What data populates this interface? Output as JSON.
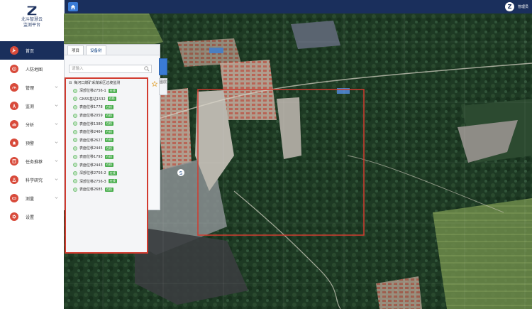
{
  "app": {
    "logo_text_line1": "北斗智慧云",
    "logo_text_line2": "监测平台",
    "user_avatar_letter": "Z",
    "user_name": "管理员"
  },
  "sidebar": {
    "items": [
      {
        "label": "首页",
        "icon": "wrench-icon",
        "active": true,
        "has_chevron": false
      },
      {
        "label": "人防地图",
        "icon": "target-icon",
        "active": false,
        "has_chevron": false
      },
      {
        "label": "管理",
        "icon": "dashboard-icon",
        "active": false,
        "has_chevron": true
      },
      {
        "label": "监测",
        "icon": "signal-tower-icon",
        "active": false,
        "has_chevron": true
      },
      {
        "label": "分析",
        "icon": "chart-icon",
        "active": false,
        "has_chevron": true
      },
      {
        "label": "预警",
        "icon": "alarm-icon",
        "active": false,
        "has_chevron": true
      },
      {
        "label": "任务推荐",
        "icon": "task-icon",
        "active": false,
        "has_chevron": true
      },
      {
        "label": "科学研究",
        "icon": "research-icon",
        "active": false,
        "has_chevron": true
      },
      {
        "label": "测量",
        "icon": "measure-icon",
        "active": false,
        "has_chevron": true
      },
      {
        "label": "设置",
        "icon": "settings-icon",
        "active": false,
        "has_chevron": false
      }
    ]
  },
  "panel": {
    "tabs": [
      {
        "label": "项目",
        "active": false
      },
      {
        "label": "设备树",
        "active": true
      }
    ],
    "search_placeholder": "请输入",
    "tree_root_label": "梅河口煤矿采煤采区边坡监测",
    "tree_items": [
      {
        "label": "深部位移2756-1",
        "badge": "在线"
      },
      {
        "label": "GNSS基站1532",
        "badge": "在线"
      },
      {
        "label": "表面位移1778",
        "badge": "在线"
      },
      {
        "label": "表面位移2059",
        "badge": "在线"
      },
      {
        "label": "表面位移1380",
        "badge": "在线"
      },
      {
        "label": "表面位移2464",
        "badge": "在线"
      },
      {
        "label": "表面位移2627",
        "badge": "在线"
      },
      {
        "label": "表面位移2445",
        "badge": "在线"
      },
      {
        "label": "表面位移1793",
        "badge": "在线"
      },
      {
        "label": "表面位移2443",
        "badge": "在线"
      },
      {
        "label": "深部位移2756-2",
        "badge": "在线"
      },
      {
        "label": "深部位移2756-3",
        "badge": "在线"
      },
      {
        "label": "表面位移2685",
        "badge": "在线"
      }
    ],
    "side_button_label": "图层"
  },
  "colors": {
    "nav_active": "#1a2f5c",
    "topbar": "#1a2f5c",
    "icon_red": "#d84a3a",
    "highlight_red": "#d23b2f",
    "badge_green": "#4caf50"
  }
}
